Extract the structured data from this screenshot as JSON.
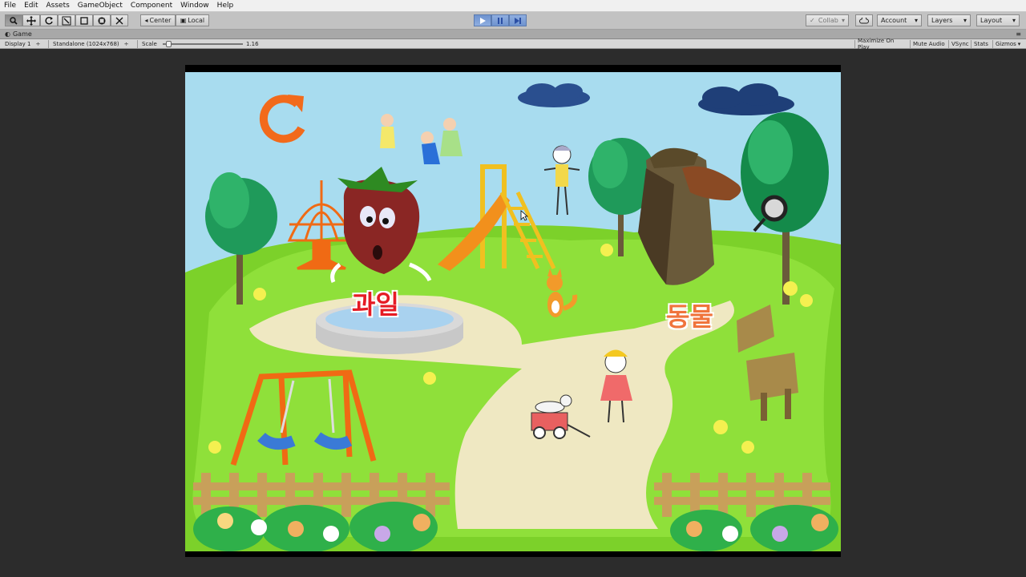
{
  "menu": {
    "items": [
      "File",
      "Edit",
      "Assets",
      "GameObject",
      "Component",
      "Window",
      "Help"
    ]
  },
  "toolbar": {
    "tools": [
      "hand-tool",
      "move-tool",
      "rotate-tool",
      "scale-tool",
      "rect-tool",
      "transform-tool",
      "custom-tool"
    ],
    "pivot_label": "Center",
    "space_label": "Local",
    "collab_label": "Collab",
    "account_label": "Account",
    "layers_label": "Layers",
    "layout_label": "Layout"
  },
  "game_tab": {
    "title": "Game"
  },
  "game_bar": {
    "display": "Display 1",
    "resolution": "Standalone (1024x768)",
    "scale_label": "Scale",
    "scale_value": "1.16",
    "maximize": "Maximize On Play",
    "mute": "Mute Audio",
    "vsync": "VSync",
    "stats": "Stats",
    "gizmos": "Gizmos"
  },
  "scene": {
    "fruit_label": "과일",
    "animal_label": "동물",
    "colors": {
      "sky": "#a8dcef",
      "grass": "#7cd12a",
      "path": "#efe8c2",
      "fruit_label": "#e51b24",
      "animal_label": "#f0743c",
      "reload": "#f26a1b"
    }
  }
}
